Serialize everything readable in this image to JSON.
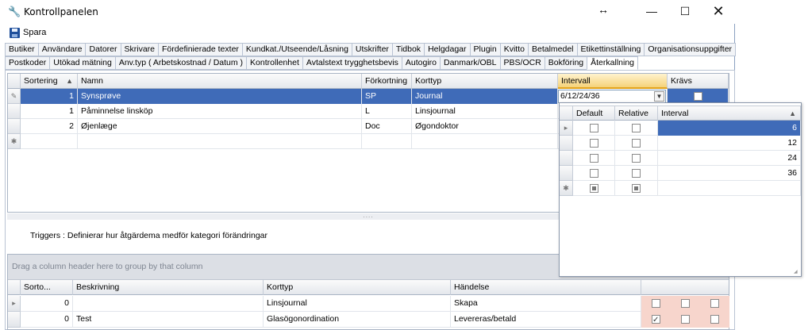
{
  "window": {
    "title": "Kontrollpanelen",
    "wrench_icon": "wrench-icon",
    "resize_glyph": "↔",
    "minimize_glyph": "—",
    "maximize_glyph": "☐",
    "close_glyph": "✕"
  },
  "toolbar": {
    "save_label": "Spara"
  },
  "tabs_row1": [
    "Butiker",
    "Användare",
    "Datorer",
    "Skrivare",
    "Fördefinierade texter",
    "Kundkat./Utseende/Låsning",
    "Utskrifter",
    "Tidbok",
    "Helgdagar",
    "Plugin",
    "Kvitto",
    "Betalmedel",
    "Etikettinställning",
    "Organisationsuppgifter"
  ],
  "tabs_row2": [
    "Postkoder",
    "Utökad mätning",
    "Anv.typ ( Arbetskostnad / Datum )",
    "Kontrollenhet",
    "Avtalstext trygghetsbevis",
    "Autogiro",
    "Danmark/OBL",
    "PBS/OCR",
    "Bokföring",
    "Återkallning"
  ],
  "active_tab": "Återkallning",
  "upper_grid": {
    "columns": [
      "Sortering",
      "Namn",
      "Förkortning",
      "Korttyp",
      "Intervall",
      "Krävs"
    ],
    "rows": [
      {
        "sortering": "1",
        "namn": "Synsprøve",
        "forkortning": "SP",
        "korttyp": "Journal",
        "intervall": "6/12/24/36",
        "kravs": false,
        "selected": true
      },
      {
        "sortering": "1",
        "namn": "Påminnelse linsköp",
        "forkortning": "L",
        "korttyp": "Linsjournal",
        "intervall": "",
        "kravs": false,
        "selected": false
      },
      {
        "sortering": "2",
        "namn": "Øjenlæge",
        "forkortning": "Doc",
        "korttyp": "Øgondoktor",
        "intervall": "",
        "kravs": false,
        "selected": false
      }
    ]
  },
  "popup": {
    "columns": [
      "Default",
      "Relative",
      "Interval"
    ],
    "rows": [
      {
        "default": false,
        "relative": false,
        "interval": "6",
        "selected": true
      },
      {
        "default": false,
        "relative": false,
        "interval": "12",
        "selected": false
      },
      {
        "default": false,
        "relative": false,
        "interval": "24",
        "selected": false
      },
      {
        "default": false,
        "relative": false,
        "interval": "36",
        "selected": false
      }
    ]
  },
  "triggers_text": "Triggers : Definierar hur åtgärdema medför kategori förändringar",
  "lower_grid": {
    "group_placeholder": "Drag a column header here to group by that column",
    "columns": [
      "Sorto...",
      "Beskrivning",
      "Korttyp",
      "Händelse"
    ],
    "rows": [
      {
        "sort": "0",
        "beskrivning": "",
        "korttyp": "Linsjournal",
        "handelse": "Skapa",
        "c1": false,
        "c2": false,
        "c3": false
      },
      {
        "sort": "0",
        "beskrivning": "Test",
        "korttyp": "Glasögonordination",
        "handelse": "Levereras/betald",
        "c1": true,
        "c2": false,
        "c3": false
      }
    ]
  },
  "colors": {
    "selection": "#3f6bb8",
    "highlight_header": "#f5d27a",
    "pink_cells": "#f7d5cc"
  }
}
